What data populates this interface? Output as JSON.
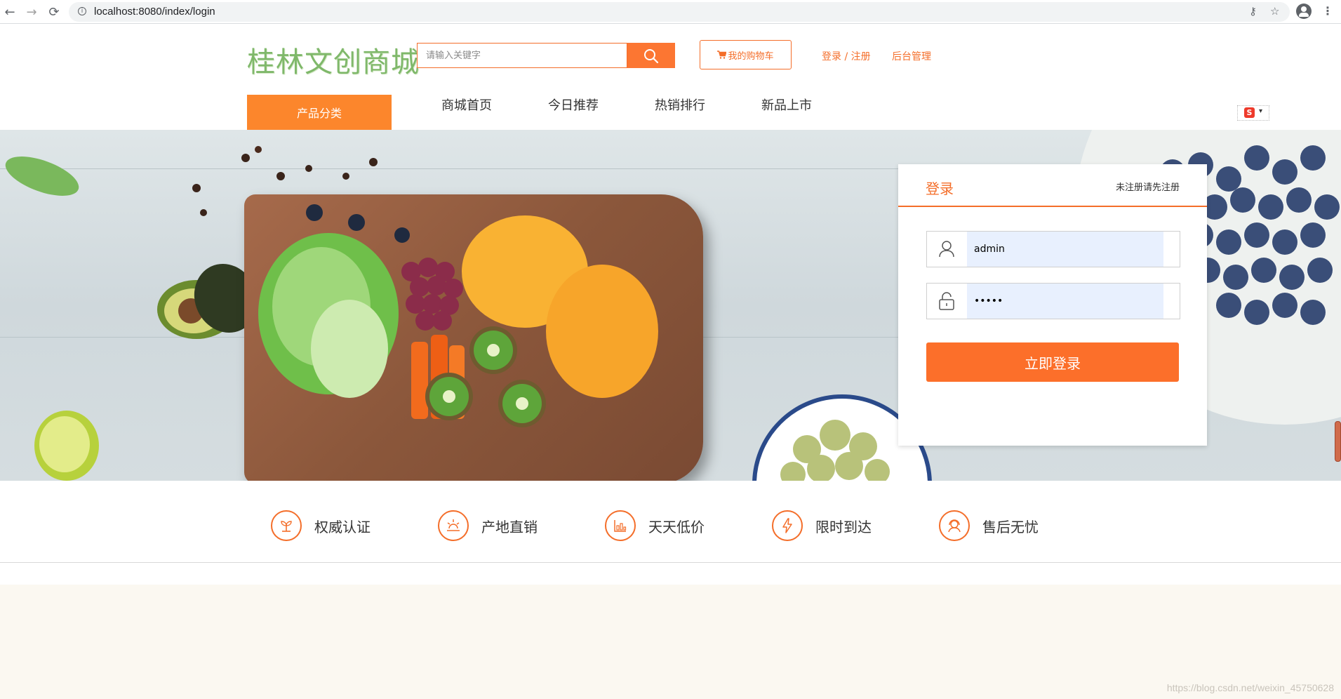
{
  "browser": {
    "url": "localhost:8080/index/login",
    "back_icon": "←",
    "forward_icon": "→",
    "reload_icon": "⟳",
    "info_icon": "i",
    "key_icon": "⚷",
    "star_icon": "☆",
    "menu_icon": "⋮"
  },
  "header": {
    "logo_text": "桂林文创商城",
    "search_placeholder": "请输入关键字",
    "cart_label": "我的购物车",
    "login_register_link": "登录 / 注册",
    "admin_link": "后台管理"
  },
  "nav": {
    "category_label": "产品分类",
    "links": [
      "商城首页",
      "今日推荐",
      "热销排行",
      "新品上市"
    ],
    "lang_badge": "S",
    "lang_caret": "▾"
  },
  "login": {
    "title": "登录",
    "register_prompt": "未注册请先注册",
    "username_value": "admin",
    "password_value": "•••••",
    "submit_label": "立即登录"
  },
  "features": [
    {
      "label": "权威认证",
      "icon": "sprout-icon"
    },
    {
      "label": "产地直销",
      "icon": "sun-icon"
    },
    {
      "label": "天天低价",
      "icon": "chart-icon"
    },
    {
      "label": "限时到达",
      "icon": "lightning-icon"
    },
    {
      "label": "售后无忧",
      "icon": "headset-icon"
    }
  ],
  "watermark": "https://blog.csdn.net/weixin_45750628",
  "colors": {
    "accent": "#f46e2a",
    "logo": "#7fb86a",
    "bottom_bg": "#fbf8f1"
  }
}
